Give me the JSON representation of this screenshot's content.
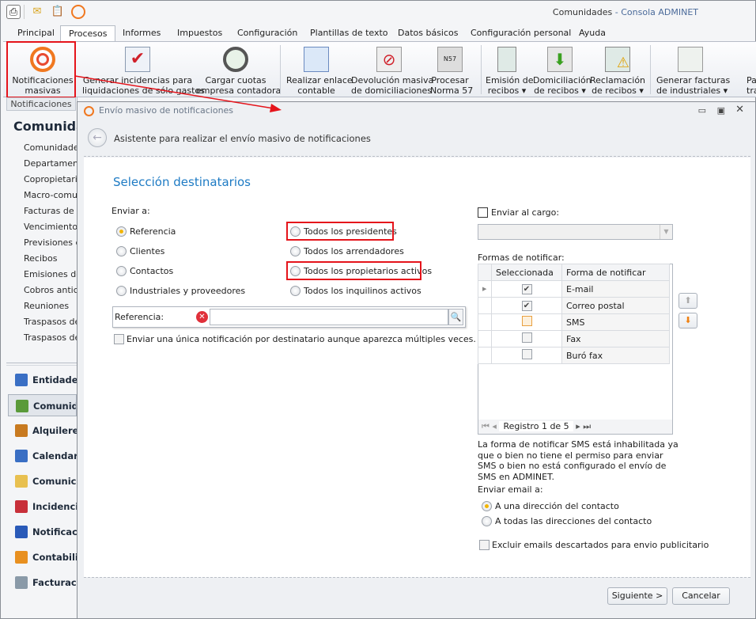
{
  "app": {
    "title_doc": "Comunidades",
    "title_sep": " - ",
    "title_app": "Consola ADMINET"
  },
  "quick_access": [
    {
      "icon": "print-icon"
    },
    {
      "icon": "mail-icon"
    },
    {
      "icon": "clipboard-icon"
    },
    {
      "icon": "broadcast-icon"
    }
  ],
  "tabs": [
    {
      "label": "Principal"
    },
    {
      "label": "Procesos",
      "active": true
    },
    {
      "label": "Informes"
    },
    {
      "label": "Impuestos"
    },
    {
      "label": "Configuración"
    },
    {
      "label": "Plantillas de texto"
    },
    {
      "label": "Datos básicos"
    },
    {
      "label": "Configuración personal"
    },
    {
      "label": "Ayuda"
    }
  ],
  "ribbon": {
    "group_label": "Notificaciones",
    "buttons": [
      {
        "l1": "Notificaciones",
        "l2": "masivas",
        "icon": "broadcast-icon"
      },
      {
        "l1": "Generar incidencias para",
        "l2": "liquidaciones de sólo gastos",
        "icon": "clipboard-check-icon"
      },
      {
        "l1": "Cargar cuotas",
        "l2": "empresa contadora",
        "icon": "gauge-icon"
      },
      {
        "l1": "Realizar enlace",
        "l2": "contable",
        "icon": "spreadsheet-coins-icon"
      },
      {
        "l1": "Devolución masiva",
        "l2": "de domiciliaciones",
        "icon": "return-icon"
      },
      {
        "l1": "Procesar",
        "l2": "Norma 57",
        "icon": "n57-icon"
      },
      {
        "l1": "Emisión de",
        "l2": "recibos ▾",
        "icon": "receipt-icon"
      },
      {
        "l1": "Domiciliación",
        "l2": "de recibos ▾",
        "icon": "download-doc-icon"
      },
      {
        "l1": "Reclamación",
        "l2": "de recibos ▾",
        "icon": "warning-doc-icon"
      },
      {
        "l1": "Generar facturas",
        "l2": "de industriales ▾",
        "icon": "invoice-icon"
      },
      {
        "l1": "Pa",
        "l2": "transf",
        "icon": "transfer-icon"
      }
    ]
  },
  "nav": {
    "title": "Comunidades",
    "items": [
      "Comunidades",
      "Departamentos",
      "Copropietarios",
      "Macro-comunidades",
      "Facturas de industriales",
      "Vencimientos",
      "Previsiones de",
      "Recibos",
      "Emisiones de recibos",
      "Cobros anticipados",
      "Reuniones",
      "Traspasos de",
      "Traspasos de"
    ],
    "modules": [
      {
        "label": "Entidades",
        "color": "#3a6fc4"
      },
      {
        "label": "Comunidades",
        "color": "#5a9a3a",
        "selected": true
      },
      {
        "label": "Alquileres",
        "color": "#c87a20"
      },
      {
        "label": "Calendario",
        "color": "#3a6fc4"
      },
      {
        "label": "Comunicaciones",
        "color": "#e8c050"
      },
      {
        "label": "Incidencias",
        "color": "#c8303a"
      },
      {
        "label": "Notificaciones",
        "color": "#2a5ab8"
      },
      {
        "label": "Contabilidad",
        "color": "#e89020"
      },
      {
        "label": "Facturación",
        "color": "#8a9aa8"
      }
    ]
  },
  "dialog": {
    "title": "Envío masivo de notificaciones",
    "header": "Asistente para realizar el envío masivo de notificaciones",
    "section": "Selección destinatarios",
    "send_to_label": "Enviar a:",
    "options_left": [
      {
        "label": "Referencia",
        "checked": true
      },
      {
        "label": "Clientes"
      },
      {
        "label": "Contactos"
      },
      {
        "label": "Industriales y proveedores"
      }
    ],
    "options_right": [
      {
        "label": "Todos los presidentes",
        "highlighted": true
      },
      {
        "label": "Todos los arrendadores"
      },
      {
        "label": "Todos los propietarios activos",
        "highlighted": true
      },
      {
        "label": "Todos los inquilinos activos"
      }
    ],
    "reference_label": "Referencia:",
    "reference_value": "",
    "unique_label": "Enviar una única notificación por destinatario aunque aparezca múltiples veces.",
    "unique_checked": false,
    "cargo_label": "Enviar al cargo:",
    "cargo_checked": false,
    "cargo_value": "",
    "formas_label": "Formas de notificar:",
    "grid": {
      "columns": [
        "Seleccionada",
        "Forma de notificar"
      ],
      "rows": [
        {
          "checked": true,
          "name": "E-mail"
        },
        {
          "checked": true,
          "name": "Correo postal"
        },
        {
          "checked": false,
          "name": "SMS",
          "disabled": true
        },
        {
          "checked": false,
          "name": "Fax"
        },
        {
          "checked": false,
          "name": "Buró fax"
        }
      ],
      "nav_text": "Registro 1 de 5"
    },
    "sms_note": "La forma de notificar SMS está inhabilitada ya que o bien no tiene el permiso para enviar SMS o bien no está configurado el envío de SMS en ADMINET.",
    "email_label": "Enviar email a:",
    "email_options": [
      {
        "label": "A una dirección del contacto",
        "checked": true
      },
      {
        "label": "A todas las direcciones del contacto"
      }
    ],
    "exclude_label": "Excluir emails descartados para envio publicitario",
    "exclude_checked": false,
    "next": "Siguiente >",
    "cancel": "Cancelar"
  },
  "colors": {
    "accent": "#1e7bc4",
    "annotation": "#e5141b",
    "radio_on": "#f2b400"
  }
}
